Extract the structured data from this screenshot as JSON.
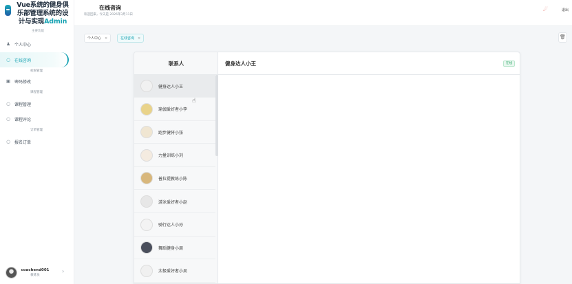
{
  "brand": {
    "title_line1": "Vue系统的健身俱",
    "title_line2": "乐部管理系统的设",
    "title_line3_main": "计与实现",
    "title_line3_accent": "Admin",
    "section_label": "主要功能"
  },
  "sidebar": {
    "items": [
      {
        "label": "个人中心",
        "icon": "user-group-icon"
      },
      {
        "label": "在线咨询",
        "icon": "circle-icon",
        "active": true
      },
      {
        "label": "密码修改",
        "icon": "lock-icon"
      },
      {
        "label": "课程管理",
        "icon": "circle-icon"
      },
      {
        "label": "课程评论",
        "icon": "circle-icon"
      },
      {
        "label": "报名订单",
        "icon": "circle-icon"
      }
    ],
    "sub_labels": [
      "权限管理",
      "课程管理",
      "订单管理"
    ]
  },
  "user": {
    "name": "coachend001",
    "role": "教练员"
  },
  "header": {
    "title": "在线咨询",
    "welcome": "欢迎回来，今天是 2026年3月11日",
    "logout_label": "退出"
  },
  "tabs": [
    {
      "label": "个人中心",
      "active": false
    },
    {
      "label": "在线咨询",
      "active": true
    }
  ],
  "chat": {
    "contacts_header": "联系人",
    "current_contact": "健身达人小王",
    "status": "在线",
    "contacts": [
      {
        "name": "健身达人小王",
        "selected": true,
        "color": "#f1f1f1"
      },
      {
        "name": "瑜伽爱好者小李",
        "selected": false,
        "color": "#e9d38a"
      },
      {
        "name": "跑步健将小张",
        "selected": false,
        "color": "#f0e6d2"
      },
      {
        "name": "力量训练小刘",
        "selected": false,
        "color": "#f4ebe0"
      },
      {
        "name": "普拉提教练小陈",
        "selected": false,
        "color": "#d8b77c"
      },
      {
        "name": "游泳爱好者小赵",
        "selected": false,
        "color": "#e7e7e7"
      },
      {
        "name": "骑行达人小孙",
        "selected": false,
        "color": "#f3f3f3"
      },
      {
        "name": "舞蹈健身小周",
        "selected": false,
        "color": "#4a4f5c"
      },
      {
        "name": "太极爱好者小吴",
        "selected": false,
        "color": "#f0f0f0"
      }
    ]
  }
}
